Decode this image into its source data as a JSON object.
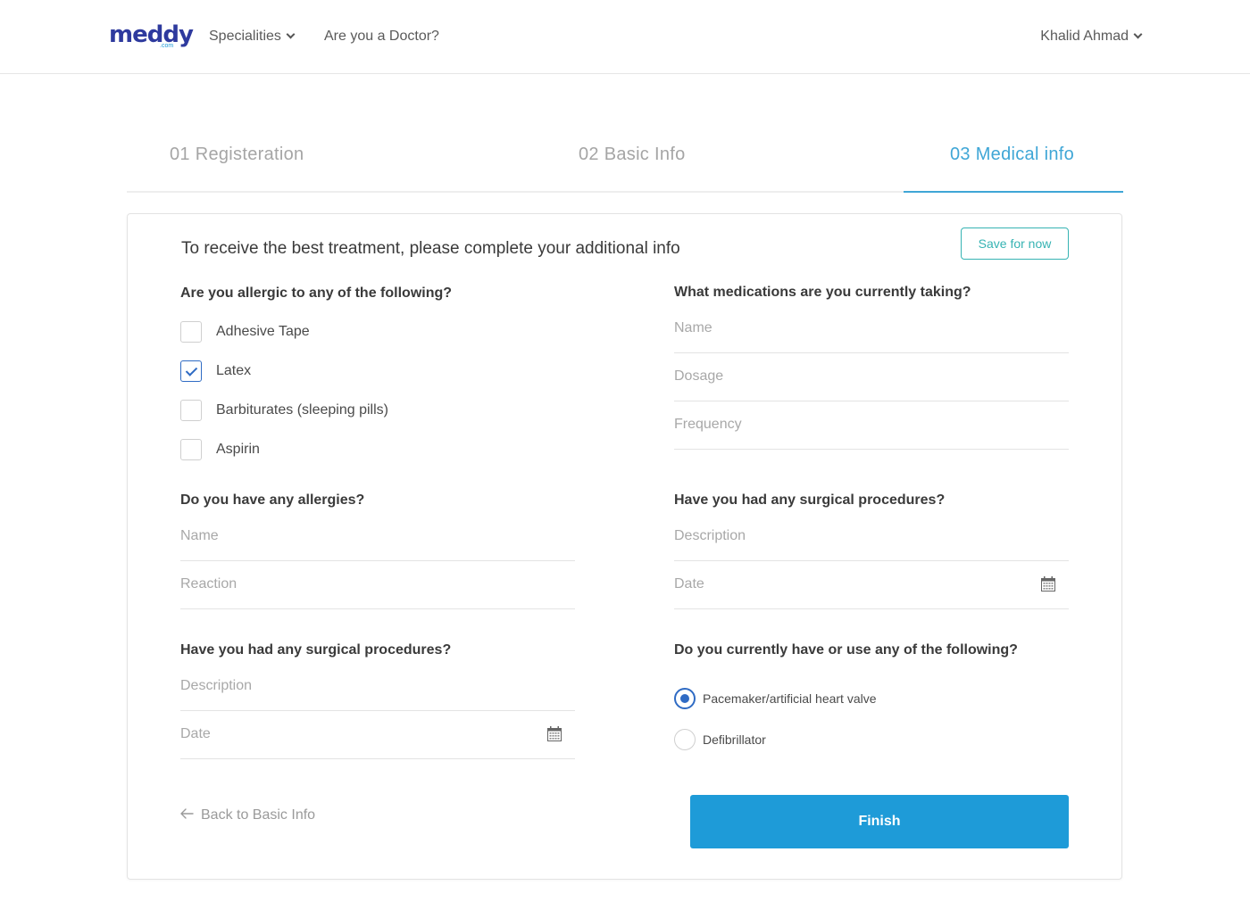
{
  "header": {
    "logo_text": "meddy",
    "logo_suffix": ".com",
    "nav_specialities": "Specialities",
    "nav_doctor": "Are you a Doctor?",
    "user_name": "Khalid Ahmad"
  },
  "steps": {
    "step1": "01 Registeration",
    "step2": "02 Basic Info",
    "step3": "03 Medical info",
    "active": 3
  },
  "form": {
    "intro": "To receive the best treatment, please complete your additional info",
    "save_label": "Save for now",
    "allergic_question": "Are you allergic to any of the following?",
    "allergic_options": [
      {
        "label": "Adhesive Tape",
        "checked": false
      },
      {
        "label": "Latex",
        "checked": true
      },
      {
        "label": "Barbiturates (sleeping pills)",
        "checked": false
      },
      {
        "label": "Aspirin",
        "checked": false
      }
    ],
    "medications_question": "What medications are you currently taking?",
    "medications_fields": {
      "name": "Name",
      "dosage": "Dosage",
      "frequency": "Frequency"
    },
    "allergies_question": "Do you have any allergies?",
    "allergies_fields": {
      "name": "Name",
      "reaction": "Reaction"
    },
    "surgical_question_right": "Have you had any surgical procedures?",
    "surgical_right_fields": {
      "description": "Description",
      "date": "Date"
    },
    "surgical_question_left": "Have you had any surgical procedures?",
    "surgical_left_fields": {
      "description": "Description",
      "date": "Date"
    },
    "devices_question": "Do you currently have or use any of the following?",
    "devices_options": [
      {
        "label": "Pacemaker/artificial heart valve",
        "selected": true
      },
      {
        "label": "Defibrillator",
        "selected": false
      }
    ],
    "back_label": "Back to Basic Info",
    "finish_label": "Finish"
  },
  "colors": {
    "brand": "#2e3a9e",
    "accent": "#1e9bd8",
    "active_step": "#3fa6d6",
    "save_border": "#36b3b3",
    "check": "#2f6bc4"
  },
  "icons": {
    "dropdown": "chevron-down-icon",
    "calendar": "calendar-icon",
    "back": "arrow-left-icon",
    "check": "check-icon"
  }
}
